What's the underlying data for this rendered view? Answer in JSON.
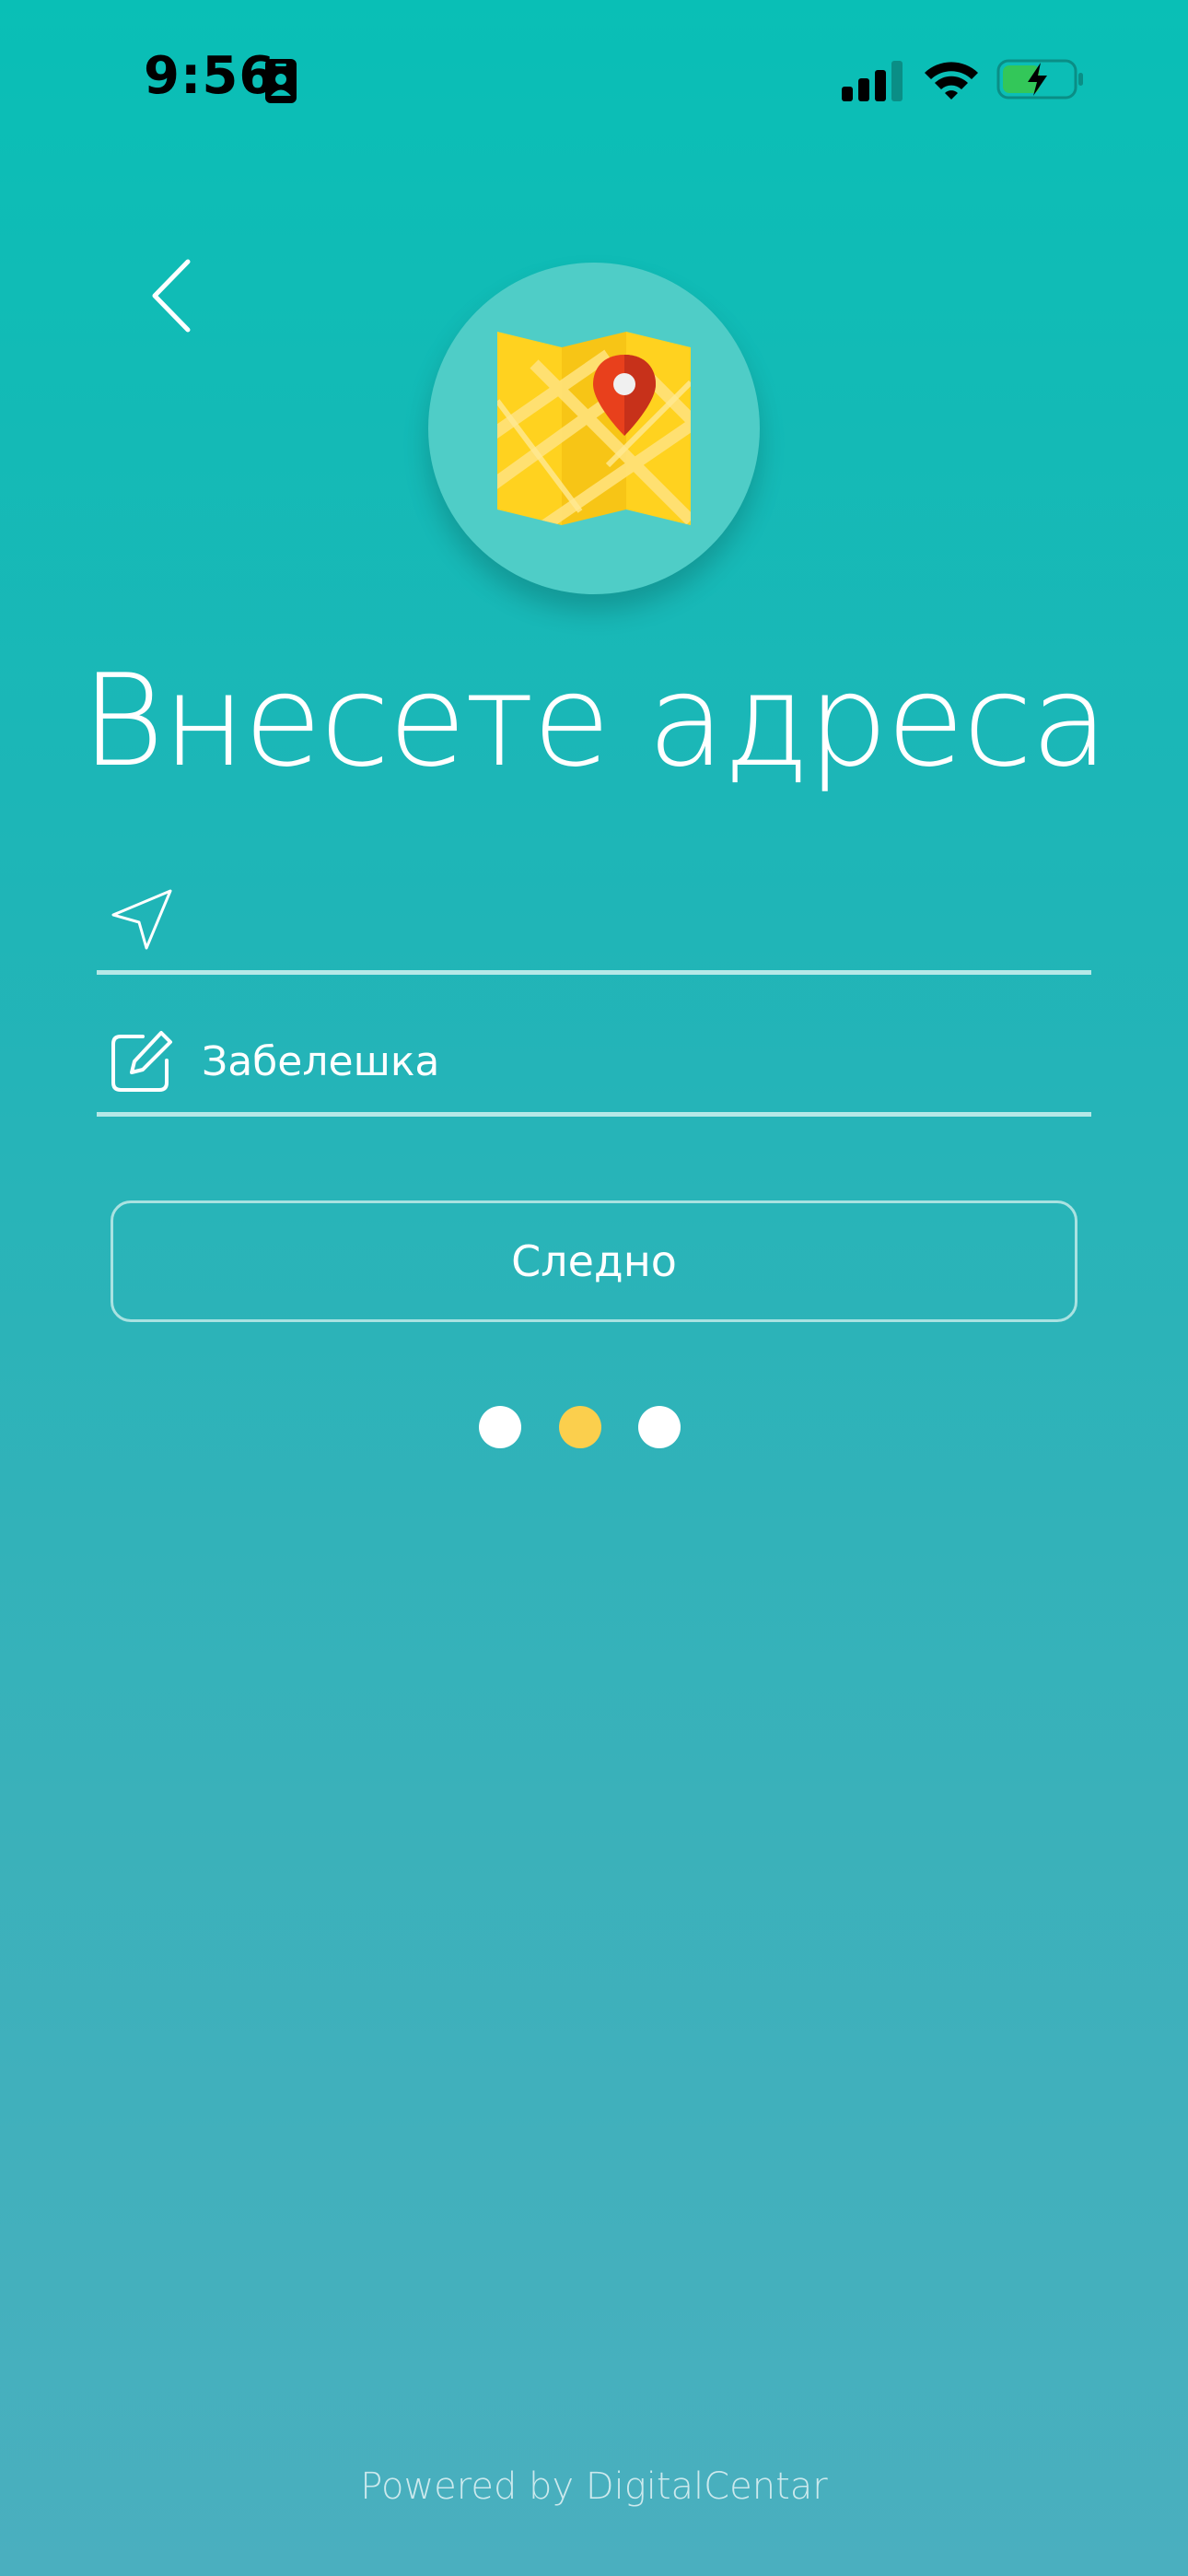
{
  "status_bar": {
    "time": "9:56"
  },
  "icons": {
    "back": "chevron-left-icon",
    "map": "folded-map-with-pin-icon",
    "address_field": "navigation-arrow-icon",
    "note_field": "edit-pencil-icon",
    "id_badge": "id-badge-icon",
    "signal": "cellular-signal-icon",
    "wifi": "wifi-icon",
    "battery": "battery-charging-icon"
  },
  "main": {
    "title": "Внесете адреса",
    "address_input": {
      "value": "",
      "placeholder": ""
    },
    "note_input": {
      "value": "",
      "placeholder": "Забелешка"
    },
    "next_button_label": "Следно"
  },
  "pagination": {
    "total": 3,
    "active_index": 1,
    "active_color": "#fbcf4d",
    "inactive_color": "#ffffff"
  },
  "footer": {
    "text": "Powered by DigitalCentar"
  },
  "colors": {
    "background_top": "#09bfb6",
    "background_bottom": "#4aafbf",
    "map_circle": "#4fcdc7",
    "map_yellow": "#ffd21f",
    "pin_red": "#e8401c"
  }
}
